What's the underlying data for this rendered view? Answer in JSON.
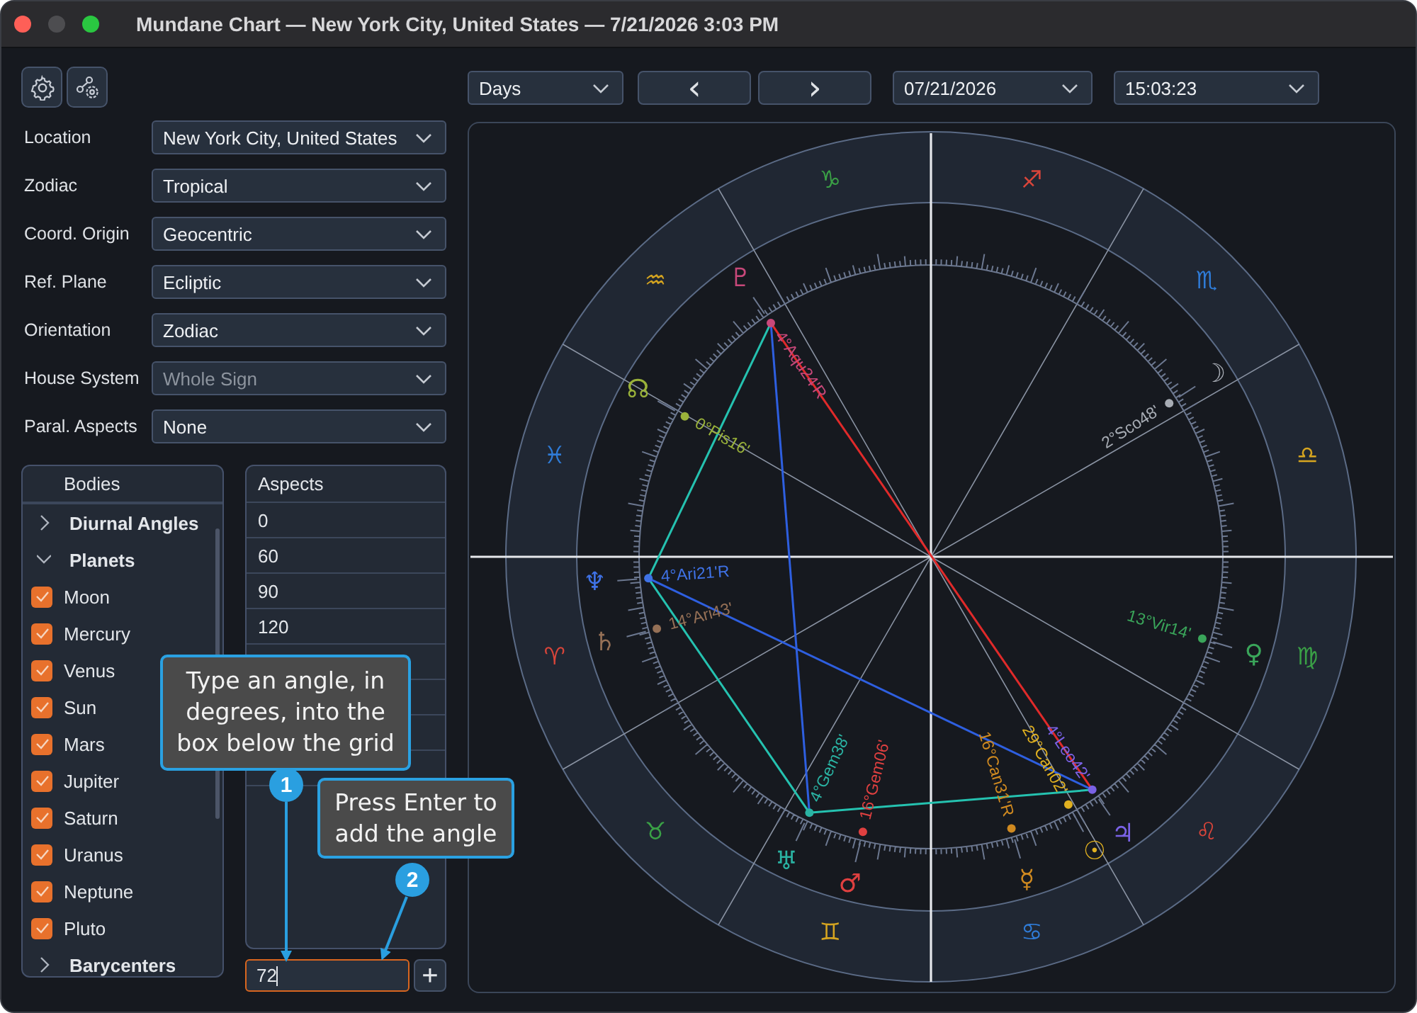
{
  "window": {
    "title": "Mundane Chart — New York City, United States — 7/21/2026 3:03 PM"
  },
  "settings": [
    {
      "label": "Location",
      "value": "New York City, United States",
      "disabled": false
    },
    {
      "label": "Zodiac",
      "value": "Tropical",
      "disabled": false
    },
    {
      "label": "Coord. Origin",
      "value": "Geocentric",
      "disabled": false
    },
    {
      "label": "Ref. Plane",
      "value": "Ecliptic",
      "disabled": false
    },
    {
      "label": "Orientation",
      "value": "Zodiac",
      "disabled": false
    },
    {
      "label": "House System",
      "value": "Whole Sign",
      "disabled": true
    },
    {
      "label": "Paral. Aspects",
      "value": "None",
      "disabled": false
    }
  ],
  "bodies": {
    "header": "Bodies",
    "groups": [
      {
        "label": "Diurnal Angles",
        "expanded": false
      },
      {
        "label": "Planets",
        "expanded": true,
        "children": [
          {
            "label": "Moon",
            "checked": true
          },
          {
            "label": "Mercury",
            "checked": true
          },
          {
            "label": "Venus",
            "checked": true
          },
          {
            "label": "Sun",
            "checked": true
          },
          {
            "label": "Mars",
            "checked": true
          },
          {
            "label": "Jupiter",
            "checked": true
          },
          {
            "label": "Saturn",
            "checked": true
          },
          {
            "label": "Uranus",
            "checked": true
          },
          {
            "label": "Neptune",
            "checked": true
          },
          {
            "label": "Pluto",
            "checked": true
          }
        ]
      },
      {
        "label": "Barycenters",
        "expanded": false
      }
    ]
  },
  "aspects": {
    "header": "Aspects",
    "rows": [
      "0",
      "60",
      "90",
      "120"
    ],
    "input": {
      "value": "72"
    },
    "add_button": "+"
  },
  "toolbar": {
    "step": "Days",
    "prev": "‹",
    "next": "›",
    "date": "07/21/2026",
    "time": "15:03:23"
  },
  "wheel": {
    "signs": [
      {
        "glyph": "♈",
        "color": "#d9453a"
      },
      {
        "glyph": "♉",
        "color": "#3aa046"
      },
      {
        "glyph": "♊",
        "color": "#d6a520"
      },
      {
        "glyph": "♋",
        "color": "#2f7bd6"
      },
      {
        "glyph": "♌",
        "color": "#d9453a"
      },
      {
        "glyph": "♍",
        "color": "#3aa046"
      },
      {
        "glyph": "♎",
        "color": "#d6a520"
      },
      {
        "glyph": "♏",
        "color": "#2f7bd6"
      },
      {
        "glyph": "♐",
        "color": "#d9453a"
      },
      {
        "glyph": "♑",
        "color": "#3aa046"
      },
      {
        "glyph": "♒",
        "color": "#d6a520"
      },
      {
        "glyph": "♓",
        "color": "#2f7bd6"
      }
    ],
    "bodies": [
      {
        "glyph": "♇",
        "label": "4°Aqu24'R",
        "color": "#c8487a"
      },
      {
        "glyph": "☊",
        "label": "0°Pis16'",
        "color": "#9ab23a"
      },
      {
        "glyph": "☽",
        "label": "2°Sco48'",
        "color": "#a8adb5"
      },
      {
        "glyph": "♆",
        "label": "4°Ari21'R",
        "color": "#3f72e6"
      },
      {
        "glyph": "♄",
        "label": "14°Ari43'",
        "color": "#957056"
      },
      {
        "glyph": "♀",
        "label": "13°Vir14'",
        "color": "#3aa55a"
      },
      {
        "glyph": "♅",
        "label": "4°Gem38'",
        "color": "#2ab3a3"
      },
      {
        "glyph": "♂",
        "label": "16°Gem06'",
        "color": "#e04040"
      },
      {
        "glyph": "☿",
        "label": "16°Can31'R",
        "color": "#d08a20"
      },
      {
        "glyph": "☉",
        "label": "29°Can02'",
        "color": "#e0b020"
      },
      {
        "glyph": "♃",
        "label": "4°Leo42'",
        "color": "#7a62e6"
      }
    ],
    "aspects": [
      {
        "color": "#25c2b0"
      },
      {
        "color": "#25c2b0"
      },
      {
        "color": "#25c2b0"
      },
      {
        "color": "#2e5fe0"
      },
      {
        "color": "#2e5fe0"
      },
      {
        "color": "#e02a2a"
      }
    ]
  },
  "callouts": [
    {
      "number": "1",
      "text": "Type an angle, in degrees, into the box below the grid"
    },
    {
      "number": "2",
      "text": "Press Enter to add the angle"
    }
  ]
}
